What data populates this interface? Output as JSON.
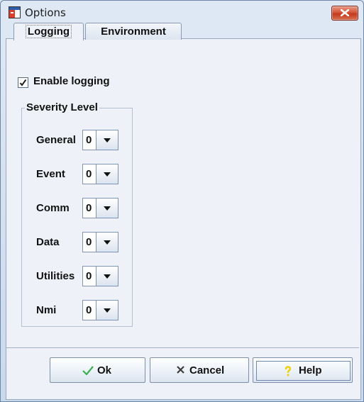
{
  "window": {
    "title": "Options",
    "close_icon": "close-icon"
  },
  "tabs": [
    {
      "label": "Logging",
      "selected": true
    },
    {
      "label": "Environment",
      "selected": false
    }
  ],
  "logging": {
    "enable_label": "Enable logging",
    "enable_checked": true,
    "group_title": "Severity Level",
    "levels": [
      {
        "label": "General",
        "value": "0"
      },
      {
        "label": "Event",
        "value": "0"
      },
      {
        "label": "Comm",
        "value": "0"
      },
      {
        "label": "Data",
        "value": "0"
      },
      {
        "label": "Utilities",
        "value": "0"
      },
      {
        "label": "Nmi",
        "value": "0"
      }
    ]
  },
  "buttons": {
    "ok_label": "Ok",
    "cancel_label": "Cancel",
    "help_label": "Help"
  },
  "colors": {
    "ok_icon": "#37b24d",
    "cancel_icon": "#3c3c3c",
    "help_icon": "#f0d000",
    "close_button": "#c9432a"
  }
}
